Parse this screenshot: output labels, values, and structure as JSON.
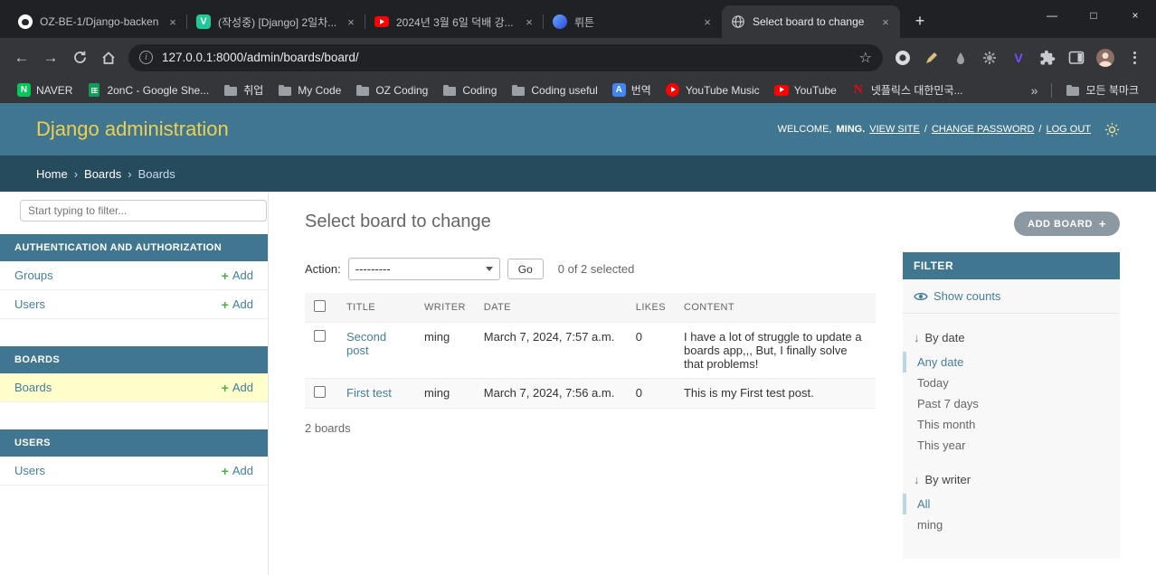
{
  "glyphs": {
    "close": "×",
    "plus": "+",
    "minimize": "—",
    "maximize": "□",
    "back": "←",
    "forward": "→",
    "star": "☆",
    "overflow_chevron": "»",
    "breadcrumb_sep": "›",
    "separator": "/",
    "filter_arrow": "↓",
    "info": "i"
  },
  "browser": {
    "tabs": [
      {
        "title": "OZ-BE-1/Django-backen..."
      },
      {
        "title": "(작성중) [Django] 2일차..."
      },
      {
        "title": "2024년 3월 6일 덕배 강..."
      },
      {
        "title": "뤼튼"
      },
      {
        "title": "Select board to change"
      }
    ],
    "url": "127.0.0.1:8000/admin/boards/board/",
    "icon_letters": {
      "naver": "N",
      "velog": "V",
      "v_ext": "V",
      "netflix": "N",
      "translate": "A"
    },
    "bookmarks": {
      "naver": "NAVER",
      "sheets": "2onC - Google She...",
      "jobs": "취업",
      "mycode": "My Code",
      "ozcoding": "OZ Coding",
      "coding": "Coding",
      "codinguseful": "Coding useful",
      "translate": "번역",
      "ytmusic": "YouTube Music",
      "youtube": "YouTube",
      "netflix": "넷플릭스 대한민국...",
      "allbookmarks": "모든 북마크"
    }
  },
  "admin": {
    "site_title": "Django administration",
    "welcome": "WELCOME,",
    "username": "MING.",
    "view_site": "VIEW SITE",
    "change_password": "CHANGE PASSWORD",
    "log_out": "LOG OUT",
    "breadcrumbs": {
      "home": "Home",
      "app": "Boards",
      "model": "Boards"
    }
  },
  "sidebar": {
    "filter_placeholder": "Start typing to filter...",
    "sections": [
      {
        "title": "AUTHENTICATION AND AUTHORIZATION",
        "rows": [
          {
            "label": "Groups",
            "add": "Add"
          },
          {
            "label": "Users",
            "add": "Add"
          }
        ]
      },
      {
        "title": "BOARDS",
        "rows": [
          {
            "label": "Boards",
            "add": "Add",
            "current": true
          }
        ]
      },
      {
        "title": "USERS",
        "rows": [
          {
            "label": "Users",
            "add": "Add"
          }
        ]
      }
    ]
  },
  "main": {
    "page_title": "Select board to change",
    "add_button_label": "ADD BOARD",
    "action_label": "Action:",
    "action_value": "---------",
    "go_label": "Go",
    "selected_info": "0 of 2 selected",
    "table": {
      "headers": [
        "TITLE",
        "WRITER",
        "DATE",
        "LIKES",
        "CONTENT"
      ],
      "rows": [
        {
          "title": "Second post",
          "writer": "ming",
          "date": "March 7, 2024, 7:57 a.m.",
          "likes": "0",
          "content": "I have a lot of struggle to update a boards app,,, But, I finally solve that problems!"
        },
        {
          "title": "First test",
          "writer": "ming",
          "date": "March 7, 2024, 7:56 a.m.",
          "likes": "0",
          "content": "This is my First test post."
        }
      ]
    },
    "result_count": "2 boards"
  },
  "filter_panel": {
    "title": "FILTER",
    "show_counts": "Show counts",
    "groups": [
      {
        "heading": "By date",
        "options": [
          {
            "label": "Any date",
            "selected": true
          },
          {
            "label": "Today"
          },
          {
            "label": "Past 7 days"
          },
          {
            "label": "This month"
          },
          {
            "label": "This year"
          }
        ]
      },
      {
        "heading": "By writer",
        "options": [
          {
            "label": "All",
            "selected": true
          },
          {
            "label": "ming"
          }
        ]
      }
    ]
  }
}
